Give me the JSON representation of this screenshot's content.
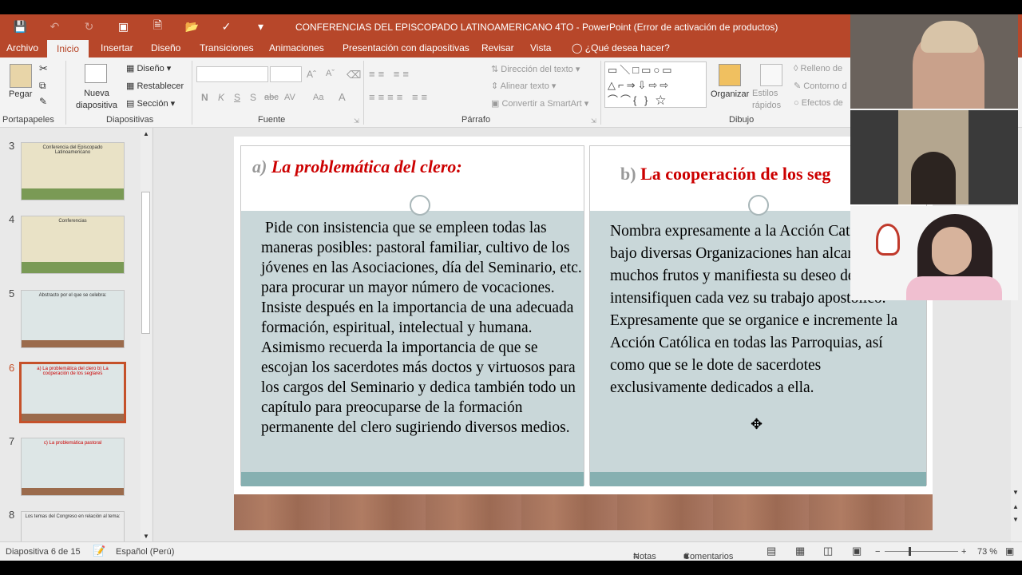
{
  "window": {
    "title": "CONFERENCIAS DEL  EPISCOPADO LATINOAMERICANO 4TO - PowerPoint (Error de activación de productos)"
  },
  "tabs": [
    "Archivo",
    "Inicio",
    "Insertar",
    "Diseño",
    "Transiciones",
    "Animaciones",
    "Presentación con diapositivas",
    "Revisar",
    "Vista"
  ],
  "tell_me": "¿Qué desea hacer?",
  "ribbon": {
    "paste": "Pegar",
    "new_slide": "Nueva diapositiva",
    "layout": "Diseño",
    "reset": "Restablecer",
    "section": "Sección",
    "text_direction": "Dirección del texto",
    "align_text": "Alinear texto",
    "smartart": "Convertir a SmartArt",
    "organize": "Organizar",
    "quick_styles": "Estilos rápidos",
    "fill": "Relleno de",
    "outline": "Contorno d",
    "effects": "Efectos de",
    "bold": "N",
    "italic": "K",
    "underline": "S",
    "shadow": "S",
    "strike": "abc",
    "caps": "AV",
    "case": "Aa",
    "fontcolor": "A",
    "groups": {
      "clipboard": "Portapapeles",
      "slides": "Diapositivas",
      "font": "Fuente",
      "paragraph": "Párrafo",
      "drawing": "Dibujo"
    }
  },
  "thumbnails": [
    {
      "num": "3",
      "title": "Conferencia del Episcopado Latinoamericano"
    },
    {
      "num": "4",
      "title": "Conferencias"
    },
    {
      "num": "5",
      "title": "Abstracto por el que se celebra:"
    },
    {
      "num": "6",
      "title": "a) La problemática del clero  b) La cooperación de los seglares"
    },
    {
      "num": "7",
      "title": "c) La problemática pastoral"
    },
    {
      "num": "8",
      "title": "Los temas del Congreso en relación al tema:"
    }
  ],
  "slide": {
    "left_label": "a)",
    "left_title": "La problemática del clero:",
    "left_text": "Pide con insistencia que se empleen todas las maneras posibles: pastoral familiar, cultivo de los jóvenes en las Asociaciones, día del Seminario, etc. para procurar un mayor número de vocaciones. Insiste después en la importancia de una adecuada formación, espiritual, intelectual y humana. Asimismo recuerda la importancia de que se escojan los sacerdotes más doctos y virtuosos para los cargos del Seminario y dedica también todo un capítulo para preocuparse de la formación permanente del clero sugiriendo diversos medios.",
    "right_label": "b)",
    "right_title": "La cooperación de los seg",
    "right_text": "Nombra expresamente a la Acción Católica bajo diversas Organizaciones han alcanzado muchos frutos y manifiesta su deseo de que intensifiquen cada vez su trabajo apostólico. Expresamente que se organice e incremente la Acción Católica en todas las Parroquias, así como que se le dote de sacerdotes exclusivamente dedicados a ella."
  },
  "status": {
    "slide_info": "Diapositiva 6 de 15",
    "language": "Español (Perú)",
    "notes": "Notas",
    "comments": "Comentarios",
    "zoom": "73 %"
  }
}
